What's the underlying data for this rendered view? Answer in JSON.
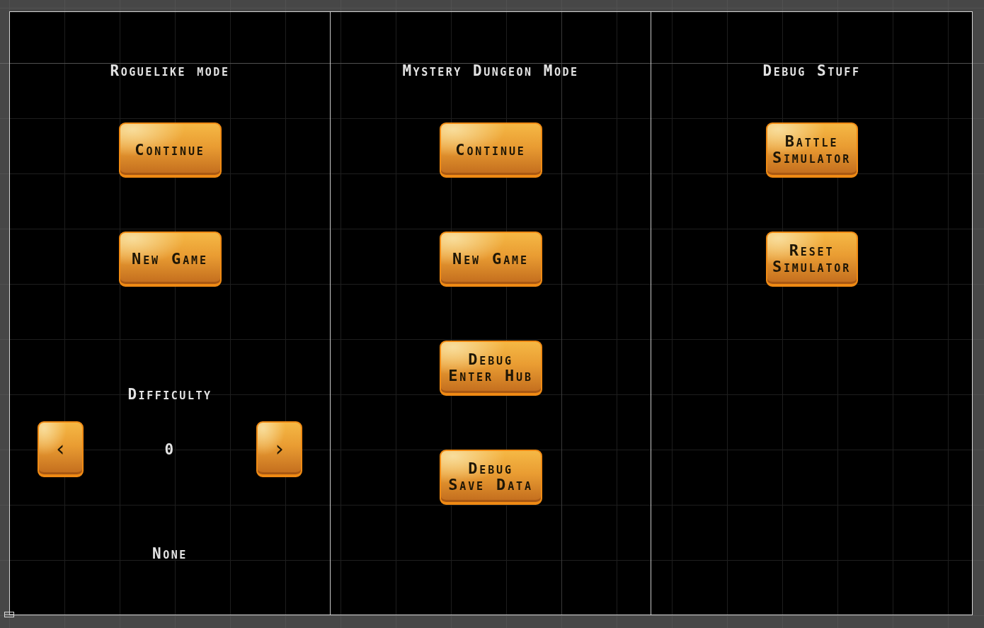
{
  "panels": [
    {
      "title": "Roguelike mode",
      "buttons": [
        "Continue",
        "New Game"
      ],
      "difficulty": {
        "label": "Difficulty",
        "decrease": "‹",
        "value": "0",
        "increase": "›",
        "setting": "None"
      }
    },
    {
      "title": "Mystery Dungeon Mode",
      "buttons": [
        "Continue",
        "New Game",
        "Debug Enter Hub",
        "Debug Save Data"
      ]
    },
    {
      "title": "Debug Stuff",
      "buttons": [
        "Battle Simulator",
        "Reset Simulator"
      ]
    }
  ]
}
